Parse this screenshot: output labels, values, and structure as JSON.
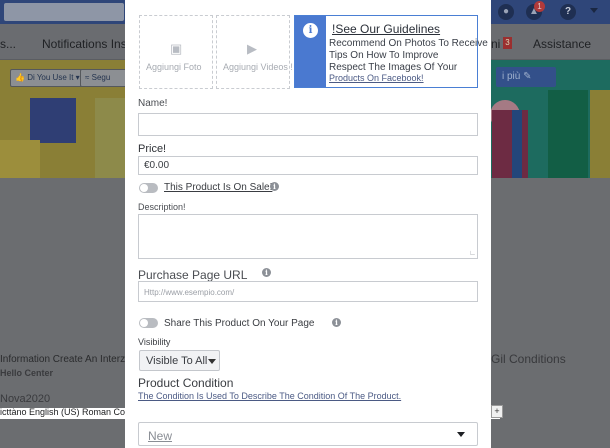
{
  "background": {
    "nav": {
      "item_left": "s...",
      "notifications": "Notifications Insi",
      "item_ni": "ni",
      "ni_badge": "3",
      "assistance": "Assistance"
    },
    "topbar": {
      "notification_count": "1",
      "help_icon": "?"
    },
    "like_button": "Di You Use It",
    "follow_button": "Segu",
    "edit_button": "i più",
    "info_line": "Information Create An Interzi",
    "help_center": "Hello Center",
    "year_line": "Nova2020",
    "language_line": "icttàno English (US) Roman Condition Selection Tool !",
    "right_text": "Gil Conditions",
    "plus_button": "+"
  },
  "modal": {
    "add_photo_label": "Aggiungi Foto",
    "add_video_label": "Aggiungi Videos !",
    "guidelines": {
      "title": "!See Our Guidelines",
      "line1": "Recommend On Photos To Receive",
      "line2": "Tips On How To Improve",
      "line3": "Respect The Images Of Your",
      "link": "Products On Facebook!"
    },
    "name_label": "Name!",
    "name_value": "",
    "price_label": "Price!",
    "price_value": "€0.00",
    "on_sale_label": "This Product Is On Sale!",
    "description_label": "Description!",
    "description_value": "",
    "purchase_url_label": "Purchase Page URL",
    "purchase_url_placeholder": "Http://www.esempio.com/",
    "share_label": "Share This Product On Your Page",
    "visibility_label": "Visibility",
    "visibility_value": "Visible To All",
    "condition_label": "Product Condition",
    "condition_help": "The Condition Is Used To Describe The Condition Of The Product.",
    "condition_value": "New"
  }
}
